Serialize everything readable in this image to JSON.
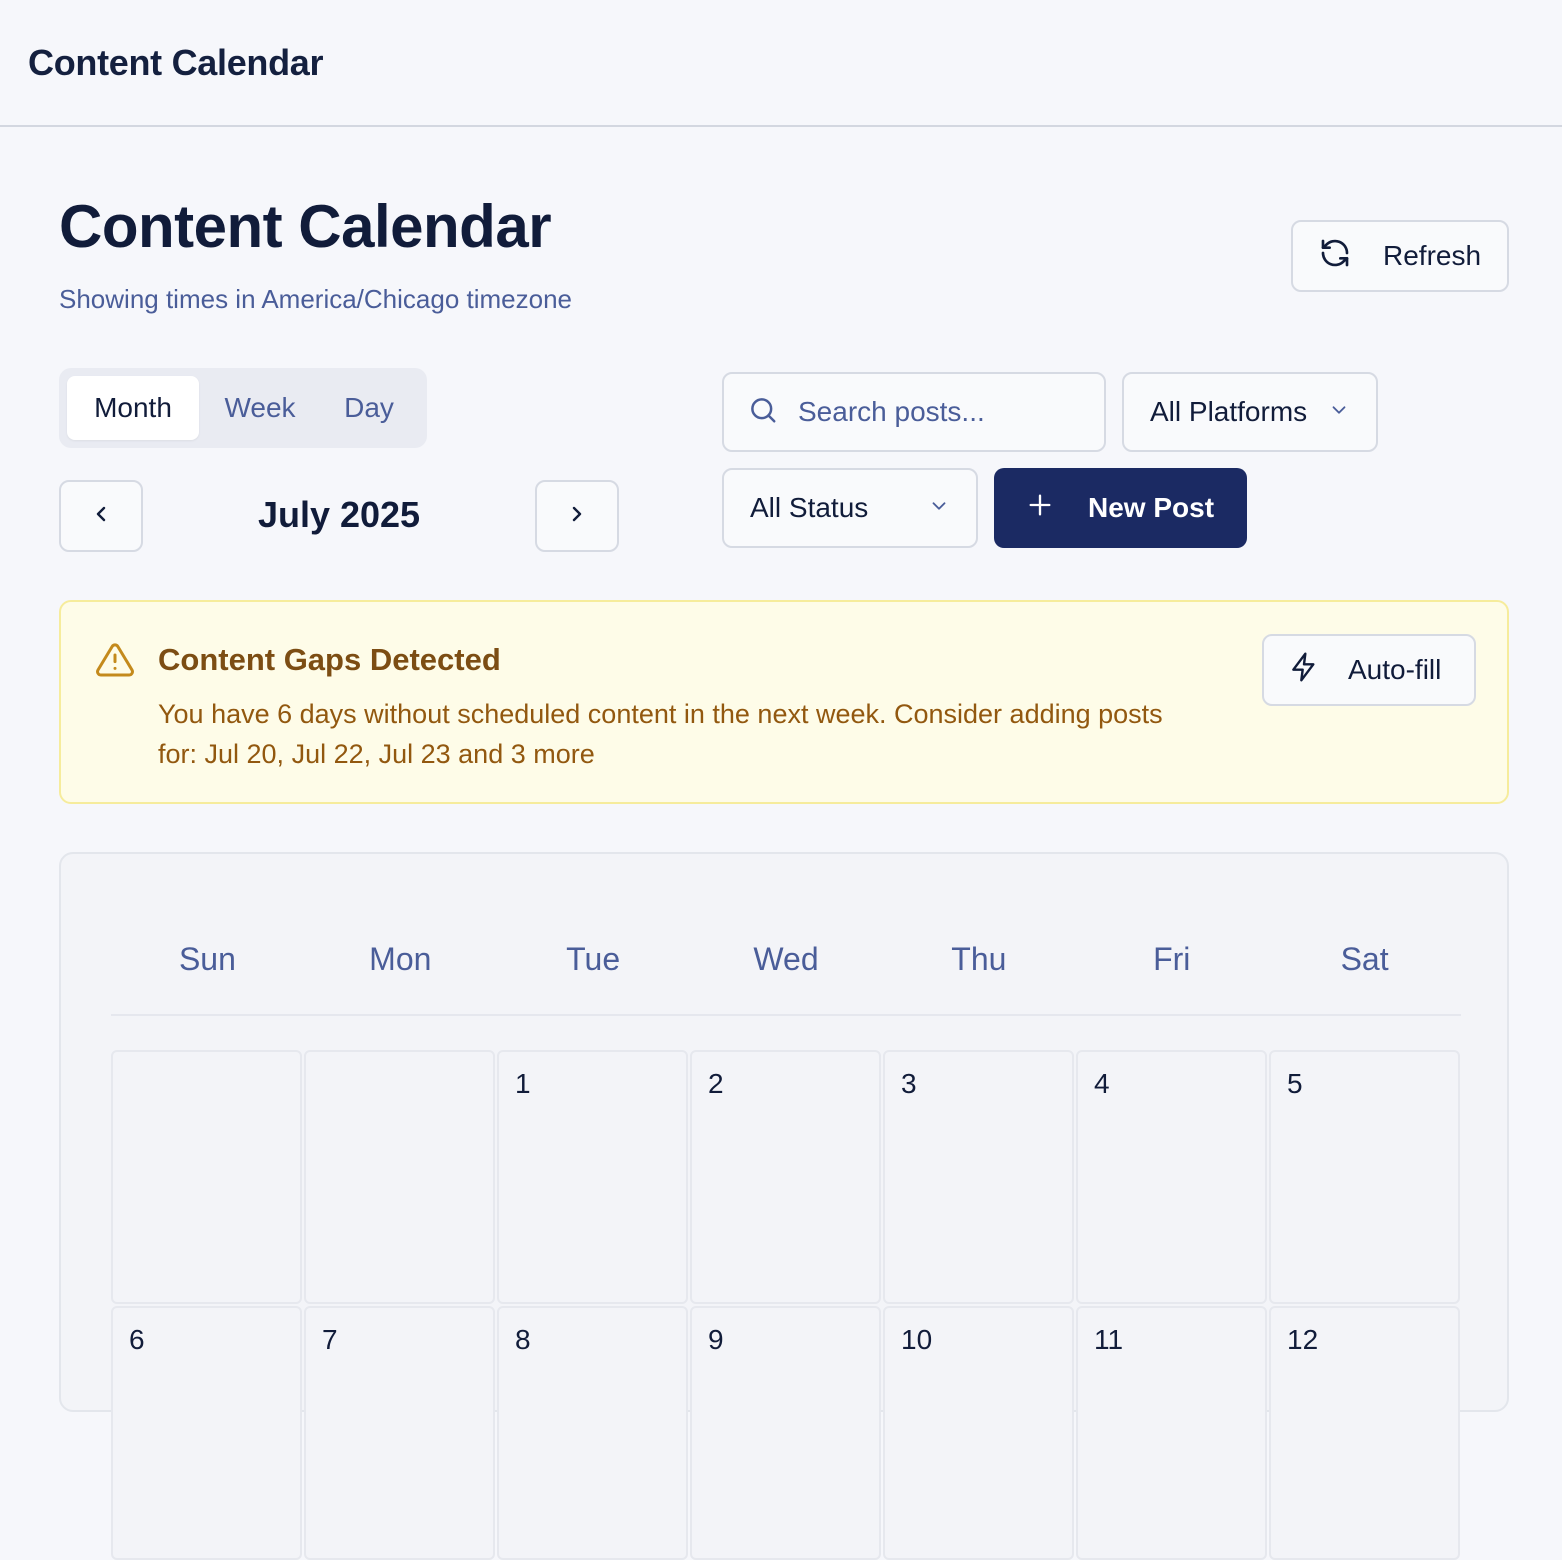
{
  "app": {
    "title": "Content Calendar"
  },
  "header": {
    "title": "Content Calendar",
    "subtitle": "Showing times in America/Chicago timezone",
    "refresh_label": "Refresh"
  },
  "view_toggle": {
    "items": [
      "Month",
      "Week",
      "Day"
    ],
    "active": "Month"
  },
  "navigation": {
    "current_month": "July 2025"
  },
  "filters": {
    "search_placeholder": "Search posts...",
    "search_value": "",
    "platform_selected": "All Platforms",
    "status_selected": "All Status",
    "new_post_label": "New Post"
  },
  "alert": {
    "title": "Content Gaps Detected",
    "message": "You have 6 days without scheduled content in the next week. Consider adding posts for: Jul 20, Jul 22, Jul 23 and 3 more",
    "action_label": "Auto-fill",
    "colors": {
      "background": "#fefce8",
      "border": "#f6ec9c",
      "text": "#92580f"
    }
  },
  "calendar": {
    "weekdays": [
      "Sun",
      "Mon",
      "Tue",
      "Wed",
      "Thu",
      "Fri",
      "Sat"
    ],
    "weeks": [
      [
        "",
        "",
        "1",
        "2",
        "3",
        "4",
        "5"
      ],
      [
        "6",
        "7",
        "8",
        "9",
        "10",
        "11",
        "12"
      ]
    ]
  },
  "icons": {
    "refresh": "refresh-icon",
    "search": "search-icon",
    "chevron": "chevron-down-icon",
    "prev": "chevron-left-icon",
    "next": "chevron-right-icon",
    "plus": "plus-icon",
    "warning": "warning-icon",
    "bolt": "lightning-icon"
  },
  "colors": {
    "primary": "#1b2a63",
    "muted": "#4a5d99",
    "text": "#111c3a"
  }
}
